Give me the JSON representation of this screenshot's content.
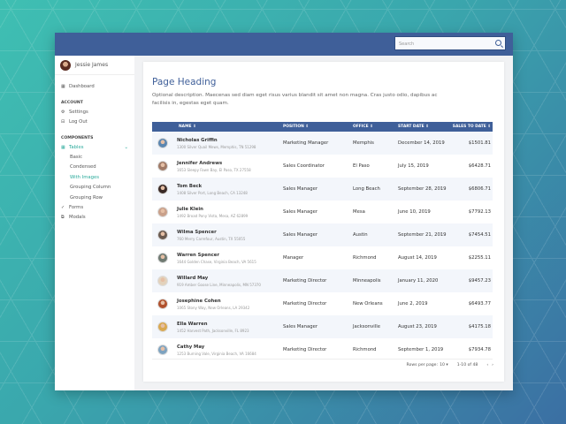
{
  "search": {
    "placeholder": "Search"
  },
  "user": {
    "name": "Jessie James"
  },
  "sidebar": {
    "dashboard": "Dashboard",
    "account_heading": "ACCOUNT",
    "settings": "Settings",
    "logout": "Log Out",
    "components_heading": "COMPONENTS",
    "tables": "Tables",
    "tables_sub": [
      "Basic",
      "Condensed",
      "With Images",
      "Grouping Column",
      "Grouping Row"
    ],
    "forms": "Forms",
    "modals": "Modals"
  },
  "page": {
    "title": "Page Heading",
    "description": "Optional description. Maecenas sed diam eget risus varius blandit sit amet non magna. Cras justo odio, dapibus ac facilisis in, egestas eget quam."
  },
  "table": {
    "headers": [
      "NAME ⇕",
      "POSITION ⇕",
      "OFFICE ⇕",
      "START DATE ⇕",
      "SALES TO DATE ⇕"
    ],
    "rows": [
      {
        "name": "Nicholas Griffin",
        "address": "1300 Silver Quail Mews, Memphis, TN 51298",
        "position": "Marketing Manager",
        "office": "Memphis",
        "start": "December 14, 2019",
        "sales": "$1501.81",
        "color": "#5b86b0"
      },
      {
        "name": "Jennifer Andrews",
        "address": "1653 Sleepy Fawn Bay, El Paso, TX 27558",
        "position": "Sales Coordinator",
        "office": "El Paso",
        "start": "July 15, 2019",
        "sales": "$6428.71",
        "color": "#a07a66"
      },
      {
        "name": "Tom Beck",
        "address": "1408 Silver Port, Long Beach, CA 13248",
        "position": "Sales Manager",
        "office": "Long Beach",
        "start": "September 28, 2019",
        "sales": "$6806.71",
        "color": "#3a2a26"
      },
      {
        "name": "Julie Klein",
        "address": "1492 Broad Pony Vista, Mesa, AZ 62899",
        "position": "Sales Manager",
        "office": "Mesa",
        "start": "June 10, 2019",
        "sales": "$7792.13",
        "color": "#c9a08a"
      },
      {
        "name": "Wilma Spencer",
        "address": "760 Merry Carrefour, Austin, TX 55055",
        "position": "Sales Manager",
        "office": "Austin",
        "start": "September 21, 2019",
        "sales": "$7454.51",
        "color": "#6a5a50"
      },
      {
        "name": "Warren Spencer",
        "address": "1644 Golden Chase, Virginia Beach, VA 5615",
        "position": "Manager",
        "office": "Richmond",
        "start": "August 14, 2019",
        "sales": "$2255.11",
        "color": "#6f7a72"
      },
      {
        "name": "Willard May",
        "address": "919 Amber Goose Line, Minneapolis, MN 57370",
        "position": "Marketing Director",
        "office": "Minneapolis",
        "start": "January 11, 2020",
        "sales": "$9457.23",
        "color": "#e3d2bc"
      },
      {
        "name": "Josephine Cohen",
        "address": "1065 Stony Way, New Orleans, LA 29342",
        "position": "Marketing Director",
        "office": "New Orleans",
        "start": "June 2, 2019",
        "sales": "$6493.77",
        "color": "#b0502c"
      },
      {
        "name": "Ella Warren",
        "address": "1452 Harvest Path, Jacksonville, FL 8923",
        "position": "Sales Manager",
        "office": "Jacksonville",
        "start": "August 23, 2019",
        "sales": "$4175.18",
        "color": "#d9a850"
      },
      {
        "name": "Cathy May",
        "address": "1253 Burning Vale, Virginia Beach, VA 16684",
        "position": "Marketing Director",
        "office": "Richmond",
        "start": "September 1, 2019",
        "sales": "$7934.78",
        "color": "#7ea3c0"
      }
    ]
  },
  "pagination": {
    "rows_per_page_label": "Rows per page:",
    "rows_per_page": "10 ▾",
    "range": "1-10 of 48",
    "prev": "‹",
    "next": "›"
  }
}
